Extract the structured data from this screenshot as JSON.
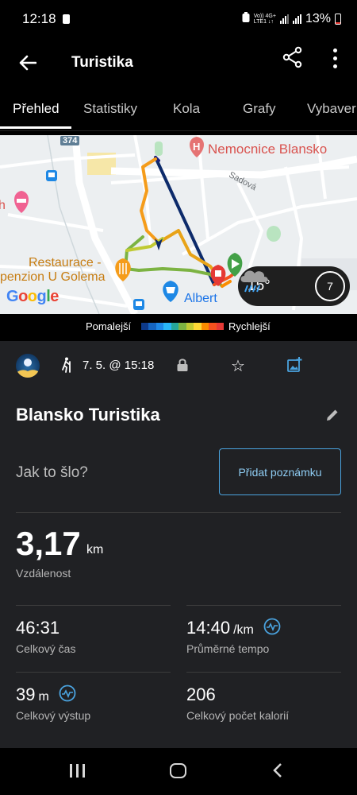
{
  "status_bar": {
    "time": "12:18",
    "network_top": "Vo)) 4G+",
    "network_bottom": "LTE1 ↓↑",
    "battery": "13%"
  },
  "app_bar": {
    "title": "Turistika",
    "back_icon": "arrow-left-icon",
    "share_icon": "share-icon",
    "more_icon": "more-vert-icon"
  },
  "tabs": [
    {
      "label": "Přehled",
      "active": true
    },
    {
      "label": "Statistiky",
      "active": false
    },
    {
      "label": "Kola",
      "active": false
    },
    {
      "label": "Grafy",
      "active": false
    },
    {
      "label": "Vybaver",
      "active": false
    }
  ],
  "map": {
    "hospital_label": "Nemocnice Blansko",
    "street_label": "Sadová",
    "restaurant_label_1": "Restaurace -",
    "restaurant_label_2": "penzion U Golema",
    "store_label": "Albert",
    "road_number": "374",
    "partial_label": "h",
    "google_letters": [
      "G",
      "o",
      "o",
      "g",
      "l",
      "e"
    ],
    "google_colors": [
      "#4285F4",
      "#EA4335",
      "#FBBC05",
      "#4285F4",
      "#34A853",
      "#EA4335"
    ],
    "weather": {
      "temperature": "15°",
      "wind": "7",
      "icon": "rain-cloud-icon"
    }
  },
  "speed_legend": {
    "slower": "Pomalejší",
    "faster": "Rychlejší",
    "colors": [
      "#0d3a8a",
      "#1565c0",
      "#1e88e5",
      "#29b6f6",
      "#26a69a",
      "#7cb342",
      "#c0ca33",
      "#fdd835",
      "#fb8c00",
      "#f4511e",
      "#e53935"
    ]
  },
  "activity": {
    "date": "7. 5. @ 15:18",
    "title": "Blansko Turistika",
    "prompt": "Jak to šlo?",
    "add_note": "Přidat poznámku"
  },
  "stats": {
    "distance": {
      "value": "3,17",
      "unit": "km",
      "label": "Vzdálenost"
    },
    "total_time": {
      "value": "46:31",
      "label": "Celkový čas"
    },
    "avg_pace": {
      "value": "14:40",
      "unit": "/km",
      "label": "Průměrné tempo"
    },
    "ascent": {
      "value": "39",
      "unit": "m",
      "label": "Celkový výstup"
    },
    "calories": {
      "value": "206",
      "label": "Celkový počet kalorií"
    }
  },
  "accent_color": "#4aa3df"
}
